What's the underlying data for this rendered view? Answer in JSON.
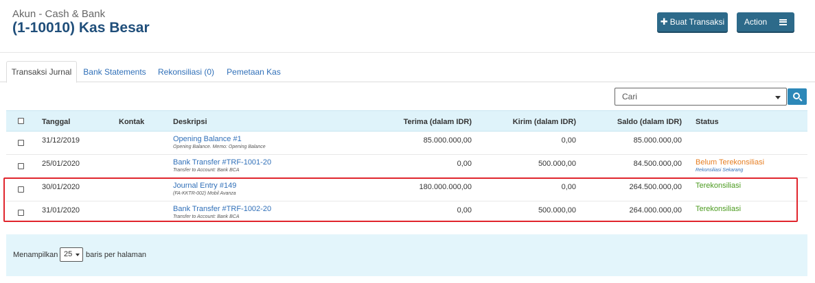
{
  "header": {
    "subtitle": "Akun - Cash & Bank",
    "title": "(1-10010) Kas Besar",
    "create_button": "Buat Transaksi",
    "action_button": "Action"
  },
  "tabs": [
    {
      "label": "Transaksi Jurnal",
      "active": true
    },
    {
      "label": "Bank Statements",
      "active": false
    },
    {
      "label": "Rekonsiliasi (0)",
      "active": false
    },
    {
      "label": "Pemetaan Kas",
      "active": false
    }
  ],
  "search": {
    "placeholder": "Cari"
  },
  "table": {
    "columns": {
      "date": "Tanggal",
      "contact": "Kontak",
      "description": "Deskripsi",
      "receive": "Terima (dalam IDR)",
      "send": "Kirim (dalam IDR)",
      "balance": "Saldo (dalam IDR)",
      "status": "Status"
    },
    "rows": [
      {
        "date": "31/12/2019",
        "contact": "",
        "description": "Opening Balance #1",
        "memo": "Opening Balance. Memo: Opening Balance",
        "receive": "85.000.000,00",
        "send": "0,00",
        "balance": "85.000.000,00",
        "status": "",
        "status_sub": ""
      },
      {
        "date": "25/01/2020",
        "contact": "",
        "description": "Bank Transfer #TRF-1001-20",
        "memo": "Transfer to Account: Bank BCA",
        "receive": "0,00",
        "send": "500.000,00",
        "balance": "84.500.000,00",
        "status": "Belum Terekonsiliasi",
        "status_sub": "Rekonsiliasi Sekarang"
      },
      {
        "date": "30/01/2020",
        "contact": "",
        "description": "Journal Entry #149",
        "memo": "(FA-KKTR-002) Mobil Avanza",
        "receive": "180.000.000,00",
        "send": "0,00",
        "balance": "264.500.000,00",
        "status": "Terekonsiliasi",
        "status_sub": ""
      },
      {
        "date": "31/01/2020",
        "contact": "",
        "description": "Bank Transfer #TRF-1002-20",
        "memo": "Transfer to Account: Bank BCA",
        "receive": "0,00",
        "send": "500.000,00",
        "balance": "264.000.000,00",
        "status": "Terekonsiliasi",
        "status_sub": ""
      }
    ]
  },
  "pagination": {
    "label_before": "Menampilkan",
    "per_page": "25",
    "label_after": "baris per halaman"
  },
  "colors": {
    "primary_button": "#2d6a8a",
    "link": "#2f6fb8",
    "unreconciled": "#e67e22",
    "reconciled": "#4a9a1e",
    "highlight_border": "#e0242c",
    "table_header_bg": "#dff3fa"
  },
  "icons": {
    "create": "plus-icon",
    "action": "menu-icon",
    "search": "search-icon"
  }
}
